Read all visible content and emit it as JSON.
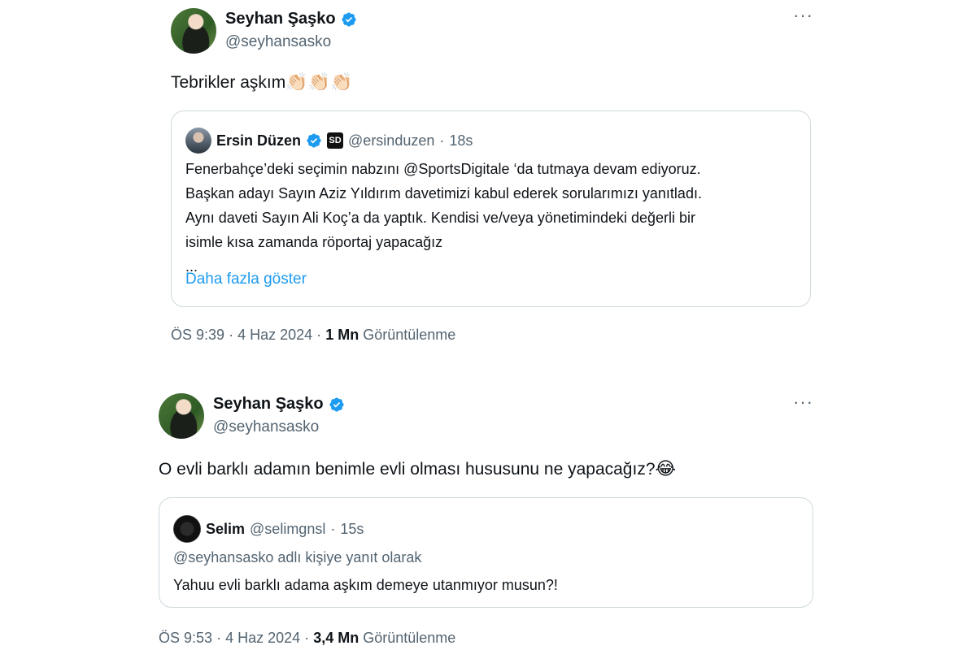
{
  "tweets": [
    {
      "author_name": "Seyhan Şaşko",
      "handle": "@seyhansasko",
      "more": "···",
      "text": "Tebrikler aşkım",
      "emoji": "👏🏻👏🏻👏🏻",
      "quote": {
        "author_name": "Ersin Düzen",
        "badge": "SD",
        "handle": "@ersinduzen",
        "separator": "·",
        "time": "18s",
        "lines": [
          "Fenerbahçe’deki seçimin nabzını @SportsDigitale ‘da tutmaya devam ediyoruz.",
          "Başkan adayı Sayın Aziz Yıldırım davetimizi kabul ederek sorularımızı yanıtladı.",
          "Aynı daveti Sayın Ali Koç’a da yaptık. Kendisi ve/veya yönetimindeki değerli bir",
          "isimle kısa zamanda röportaj yapacağız",
          "..."
        ],
        "show_more": "Daha fazla göster"
      },
      "meta": {
        "time": "ÖS 9:39",
        "sep": "·",
        "date": "4 Haz 2024",
        "views": "1 Mn",
        "views_label": "Görüntülenme"
      }
    },
    {
      "author_name": "Seyhan Şaşko",
      "handle": "@seyhansasko",
      "more": "···",
      "text": "O evli barklı adamın benimle evli olması hususunu ne yapacağız?",
      "emoji": "😂",
      "quote": {
        "author_name": "Selim",
        "handle": "@selimgnsl",
        "separator": "·",
        "time": "15s",
        "reply_to": "@seyhansasko adlı kişiye yanıt olarak",
        "line": "Yahuu evli barklı adama aşkım demeye utanmıyor musun?!"
      },
      "meta": {
        "time": "ÖS 9:53",
        "sep": "·",
        "date": "4 Haz 2024",
        "views": "3,4 Mn",
        "views_label": "Görüntülenme"
      }
    }
  ],
  "colors": {
    "verified": "#1d9bf0",
    "link": "#1d9bf0",
    "muted": "#536471",
    "border": "#cfd9de"
  }
}
